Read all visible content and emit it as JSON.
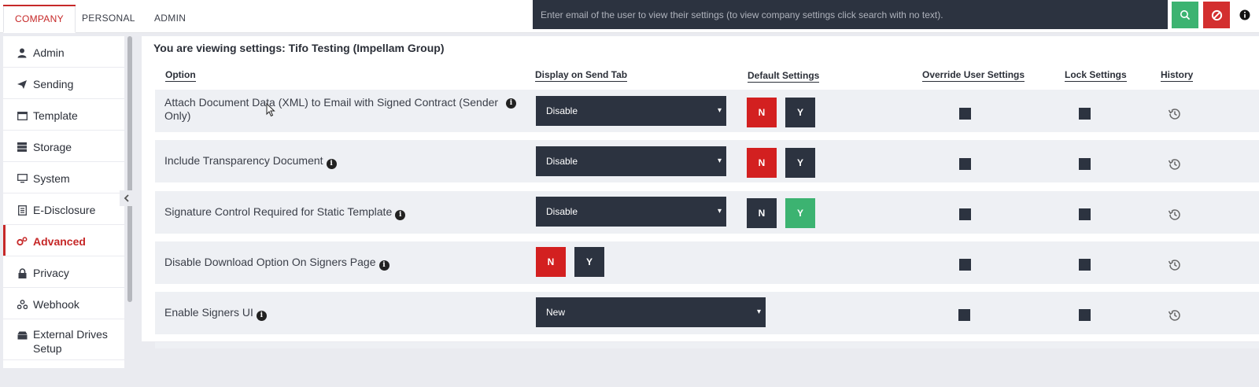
{
  "tabs": [
    "COMPANY",
    "PERSONAL",
    "ADMIN"
  ],
  "search": {
    "placeholder": "Enter email of the user to view their settings (to view company settings click search with no text)."
  },
  "sidebar": {
    "items": [
      {
        "label": "Admin",
        "icon": "user-icon"
      },
      {
        "label": "Sending",
        "icon": "paper-plane-icon"
      },
      {
        "label": "Template",
        "icon": "window-icon"
      },
      {
        "label": "Storage",
        "icon": "database-icon"
      },
      {
        "label": "System",
        "icon": "monitor-icon"
      },
      {
        "label": "E-Disclosure",
        "icon": "document-icon"
      },
      {
        "label": "Advanced",
        "icon": "cogs-icon",
        "active": true
      },
      {
        "label": "Privacy",
        "icon": "lock-icon"
      },
      {
        "label": "Webhook",
        "icon": "webhook-icon"
      },
      {
        "label": "External Drives Setup",
        "icon": "drive-icon"
      }
    ]
  },
  "viewing": {
    "label": "You are viewing settings:",
    "company": "Tifo Testing (Impellam Group)"
  },
  "headers": {
    "option": "Option",
    "display": "Display on Send Tab",
    "default": "Default Settings",
    "override": "Override User Settings",
    "lock": "Lock Settings",
    "history": "History"
  },
  "rows": [
    {
      "label": "Attach Document Data (XML) to Email with Signed Contract (Sender Only)",
      "select": "Disable",
      "n": "N",
      "y": "Y",
      "active": "N"
    },
    {
      "label": "Include Transparency Document",
      "select": "Disable",
      "n": "N",
      "y": "Y",
      "active": "N"
    },
    {
      "label": "Signature Control Required for Static Template",
      "select": "Disable",
      "n": "N",
      "y": "Y",
      "active": "Y"
    },
    {
      "label": "Disable Download Option On Signers Page",
      "n": "N",
      "y": "Y",
      "active": "N"
    },
    {
      "label": "Enable Signers UI",
      "select": "New"
    }
  ],
  "colors": {
    "accent_red": "#d32020",
    "accent_green": "#3cb371",
    "dark": "#2c3340"
  }
}
